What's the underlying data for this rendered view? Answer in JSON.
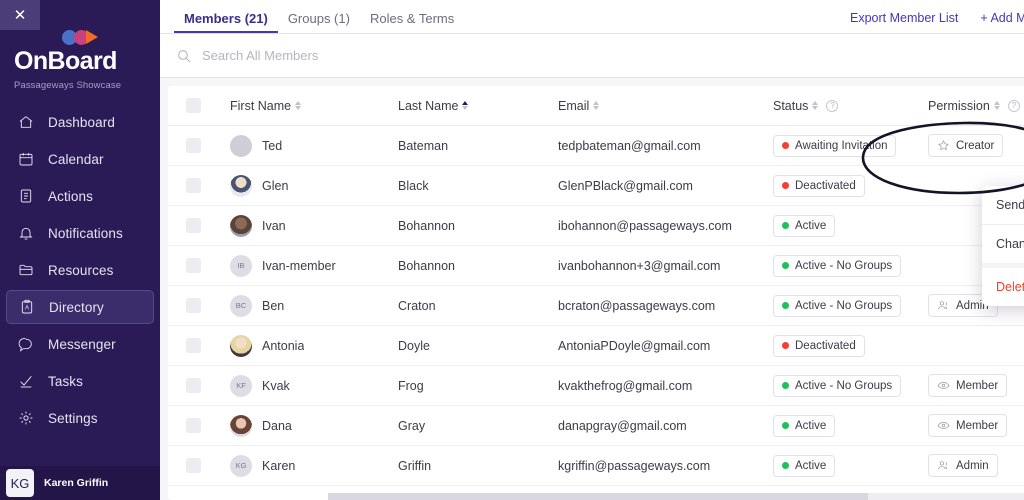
{
  "sidebar": {
    "close_label": "✕",
    "logo_text": "OnBoard",
    "org_name": "Passageways Showcase",
    "items": [
      {
        "label": "Dashboard",
        "icon": "home-icon",
        "active": false
      },
      {
        "label": "Calendar",
        "icon": "calendar-icon",
        "active": false
      },
      {
        "label": "Actions",
        "icon": "document-icon",
        "active": false
      },
      {
        "label": "Notifications",
        "icon": "bell-icon",
        "active": false
      },
      {
        "label": "Resources",
        "icon": "folder-icon",
        "active": false
      },
      {
        "label": "Directory",
        "icon": "directory-icon",
        "active": true
      },
      {
        "label": "Messenger",
        "icon": "chat-icon",
        "active": false
      },
      {
        "label": "Tasks",
        "icon": "check-icon",
        "active": false
      },
      {
        "label": "Settings",
        "icon": "gear-icon",
        "active": false
      }
    ],
    "profile": {
      "initials": "KG",
      "name": "Karen Griffin"
    },
    "colors": {
      "bg": "#2a1b56",
      "active_bg": "#3b2d6b",
      "profile_bg": "#241549"
    }
  },
  "header": {
    "tabs": [
      {
        "label": "Members (21)",
        "active": true
      },
      {
        "label": "Groups (1)",
        "active": false
      },
      {
        "label": "Roles & Terms",
        "active": false
      }
    ],
    "actions": [
      {
        "label": "Export Member List"
      },
      {
        "label": "+ Add Member"
      }
    ],
    "accent": "#4a35b5"
  },
  "search": {
    "placeholder": "Search All Members",
    "value": "",
    "icon": "search-icon"
  },
  "table": {
    "columns": [
      {
        "label": "First Name",
        "sort": "none"
      },
      {
        "label": "Last Name",
        "sort": "asc"
      },
      {
        "label": "Email",
        "sort": "none"
      },
      {
        "label": "Status",
        "sort": "none",
        "help": true
      },
      {
        "label": "Permission",
        "sort": "none",
        "help": true
      }
    ],
    "rows": [
      {
        "first_name": "Ted",
        "last_name": "Bateman",
        "email": "tedpbateman@gmail.com",
        "avatar_initials": "",
        "avatar_type": "blank",
        "status": "Awaiting Invitation",
        "status_color": "#f0402f",
        "permission": "Creator",
        "permission_icon": "star-icon"
      },
      {
        "first_name": "Glen",
        "last_name": "Black",
        "email": "GlenPBlack@gmail.com",
        "avatar_initials": "",
        "avatar_type": "photo-male-suit",
        "status": "Deactivated",
        "status_color": "#f0402f",
        "permission": "",
        "permission_icon": ""
      },
      {
        "first_name": "Ivan",
        "last_name": "Bohannon",
        "email": "ibohannon@passageways.com",
        "avatar_initials": "",
        "avatar_type": "photo-male-beard",
        "status": "Active",
        "status_color": "#21bf5b",
        "permission": "",
        "permission_icon": ""
      },
      {
        "first_name": "Ivan-member",
        "last_name": "Bohannon",
        "email": "ivanbohannon+3@gmail.com",
        "avatar_initials": "IB",
        "avatar_type": "initials",
        "status": "Active - No Groups",
        "status_color": "#21bf5b",
        "permission": "",
        "permission_icon": ""
      },
      {
        "first_name": "Ben",
        "last_name": "Craton",
        "email": "bcraton@passageways.com",
        "avatar_initials": "BC",
        "avatar_type": "initials",
        "status": "Active - No Groups",
        "status_color": "#21bf5b",
        "permission": "Admin",
        "permission_icon": "users-icon"
      },
      {
        "first_name": "Antonia",
        "last_name": "Doyle",
        "email": "AntoniaPDoyle@gmail.com",
        "avatar_initials": "",
        "avatar_type": "photo-female-blonde",
        "status": "Deactivated",
        "status_color": "#f0402f",
        "permission": "",
        "permission_icon": ""
      },
      {
        "first_name": "Kvak",
        "last_name": "Frog",
        "email": "kvakthefrog@gmail.com",
        "avatar_initials": "KF",
        "avatar_type": "initials",
        "status": "Active - No Groups",
        "status_color": "#21bf5b",
        "permission": "Member",
        "permission_icon": "eye-icon"
      },
      {
        "first_name": "Dana",
        "last_name": "Gray",
        "email": "danapgray@gmail.com",
        "avatar_initials": "",
        "avatar_type": "photo-female-dark",
        "status": "Active",
        "status_color": "#21bf5b",
        "permission": "Member",
        "permission_icon": "eye-icon"
      },
      {
        "first_name": "Karen",
        "last_name": "Griffin",
        "email": "kgriffin@passageways.com",
        "avatar_initials": "KG",
        "avatar_type": "initials",
        "status": "Active",
        "status_color": "#21bf5b",
        "permission": "Admin",
        "permission_icon": "users-icon"
      }
    ]
  },
  "context_menu": {
    "items": [
      {
        "label": "Send Invitation",
        "icon": "envelope-icon",
        "danger": false
      },
      {
        "label": "Change Permission",
        "icon": "edit-icon",
        "danger": false
      },
      {
        "label": "Delete Member",
        "icon": "trash-icon",
        "danger": true
      }
    ],
    "danger_color": "#f0402f"
  },
  "annotation": {
    "shape": "hand-drawn-ellipse",
    "target": "Awaiting Invitation",
    "color": "#141428"
  }
}
